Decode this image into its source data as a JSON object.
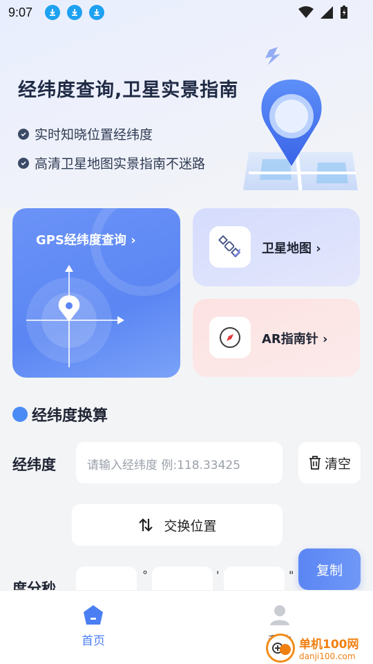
{
  "status_bar": {
    "time": "9:07"
  },
  "hero": {
    "title": "经纬度查询,卫星实景指南",
    "bullets": [
      "实时知晓位置经纬度",
      "高清卫星地图实景指南不迷路"
    ]
  },
  "cards": {
    "gps": {
      "label": "GPS经纬度查询 ›"
    },
    "satellite": {
      "label": "卫星地图 ›"
    },
    "ar": {
      "label": "AR指南针 ›"
    }
  },
  "converter": {
    "section_title": "经纬度换算",
    "latlng_label": "经纬度",
    "latlng_placeholder": "请输入经纬度 例:118.33425",
    "clear_label": "清空",
    "swap_label": "交换位置",
    "copy_label": "复制",
    "dms_label": "度分秒",
    "deg_symbol": "°",
    "min_symbol": "'",
    "sec_symbol": "\""
  },
  "bottom_nav": {
    "home_label": "首页",
    "me_label": "我的"
  },
  "watermark": {
    "main": "单机100网",
    "sub": "danji100.com"
  },
  "colors": {
    "accent": "#5b86f3",
    "watermark": "#f07f11"
  }
}
